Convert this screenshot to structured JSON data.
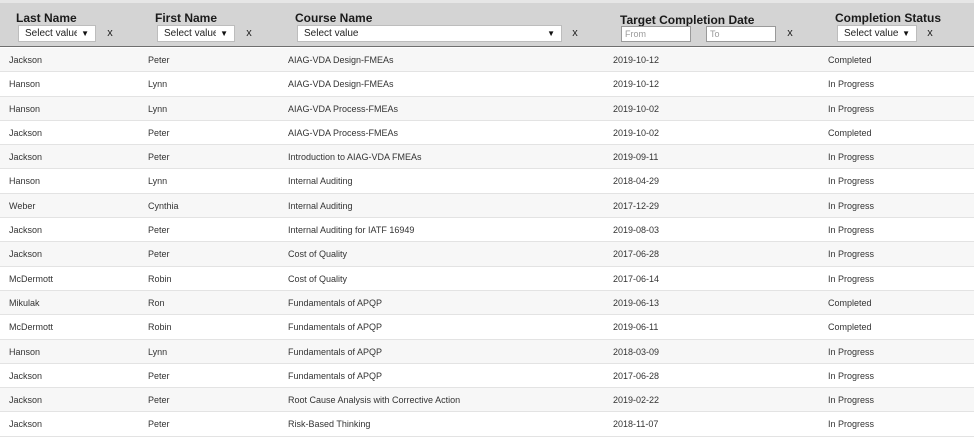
{
  "columns": {
    "last_name": {
      "title": "Last Name",
      "filter": "Select value",
      "clear": "x"
    },
    "first_name": {
      "title": "First Name",
      "filter": "Select value",
      "clear": "x"
    },
    "course_name": {
      "title": "Course Name",
      "filter": "Select value",
      "clear": "x"
    },
    "target_date": {
      "title": "Target Completion Date",
      "from_placeholder": "From",
      "to_placeholder": "To",
      "clear": "x"
    },
    "status": {
      "title": "Completion Status",
      "filter": "Select value",
      "clear": "x"
    }
  },
  "rows": [
    {
      "last": "Jackson",
      "first": "Peter",
      "course": "AIAG-VDA Design-FMEAs",
      "date": "2019-10-12",
      "status": "Completed"
    },
    {
      "last": "Hanson",
      "first": "Lynn",
      "course": "AIAG-VDA Design-FMEAs",
      "date": "2019-10-12",
      "status": "In Progress"
    },
    {
      "last": "Hanson",
      "first": "Lynn",
      "course": "AIAG-VDA Process-FMEAs",
      "date": "2019-10-02",
      "status": "In Progress"
    },
    {
      "last": "Jackson",
      "first": "Peter",
      "course": "AIAG-VDA Process-FMEAs",
      "date": "2019-10-02",
      "status": "Completed"
    },
    {
      "last": "Jackson",
      "first": "Peter",
      "course": "Introduction to AIAG-VDA FMEAs",
      "date": "2019-09-11",
      "status": "In Progress"
    },
    {
      "last": "Hanson",
      "first": "Lynn",
      "course": "Internal Auditing",
      "date": "2018-04-29",
      "status": "In Progress"
    },
    {
      "last": "Weber",
      "first": "Cynthia",
      "course": "Internal Auditing",
      "date": "2017-12-29",
      "status": "In Progress"
    },
    {
      "last": "Jackson",
      "first": "Peter",
      "course": "Internal Auditing for IATF 16949",
      "date": "2019-08-03",
      "status": "In Progress"
    },
    {
      "last": "Jackson",
      "first": "Peter",
      "course": "Cost of Quality",
      "date": "2017-06-28",
      "status": "In Progress"
    },
    {
      "last": "McDermott",
      "first": "Robin",
      "course": "Cost of Quality",
      "date": "2017-06-14",
      "status": "In Progress"
    },
    {
      "last": "Mikulak",
      "first": "Ron",
      "course": "Fundamentals of APQP",
      "date": "2019-06-13",
      "status": "Completed"
    },
    {
      "last": "McDermott",
      "first": "Robin",
      "course": "Fundamentals of APQP",
      "date": "2019-06-11",
      "status": "Completed"
    },
    {
      "last": "Hanson",
      "first": "Lynn",
      "course": "Fundamentals of APQP",
      "date": "2018-03-09",
      "status": "In Progress"
    },
    {
      "last": "Jackson",
      "first": "Peter",
      "course": "Fundamentals of APQP",
      "date": "2017-06-28",
      "status": "In Progress"
    },
    {
      "last": "Jackson",
      "first": "Peter",
      "course": "Root Cause Analysis with Corrective Action",
      "date": "2019-02-22",
      "status": "In Progress"
    },
    {
      "last": "Jackson",
      "first": "Peter",
      "course": "Risk-Based Thinking",
      "date": "2018-11-07",
      "status": "In Progress"
    }
  ]
}
